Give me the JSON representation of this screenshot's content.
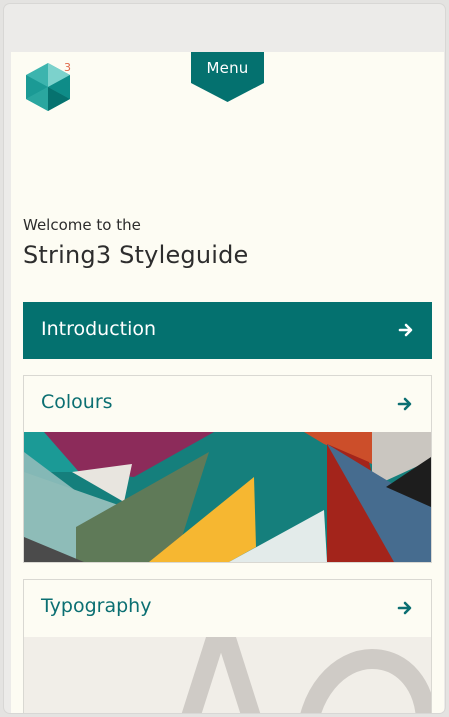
{
  "logo": {
    "superscript": "3"
  },
  "menu": {
    "label": "Menu"
  },
  "intro": {
    "welcome": "Welcome to the",
    "title": "String3 Styleguide"
  },
  "cards": [
    {
      "label": "Introduction",
      "arrow_icon": "arrow-right-icon"
    },
    {
      "label": "Colours",
      "arrow_icon": "arrow-right-icon"
    },
    {
      "label": "Typography",
      "arrow_icon": "arrow-right-icon"
    }
  ],
  "colors": {
    "teal": "#04716f",
    "page_bg": "#fdfcf3",
    "heading_teal": "#0b6f72",
    "logo_accent": "#e0694b"
  }
}
